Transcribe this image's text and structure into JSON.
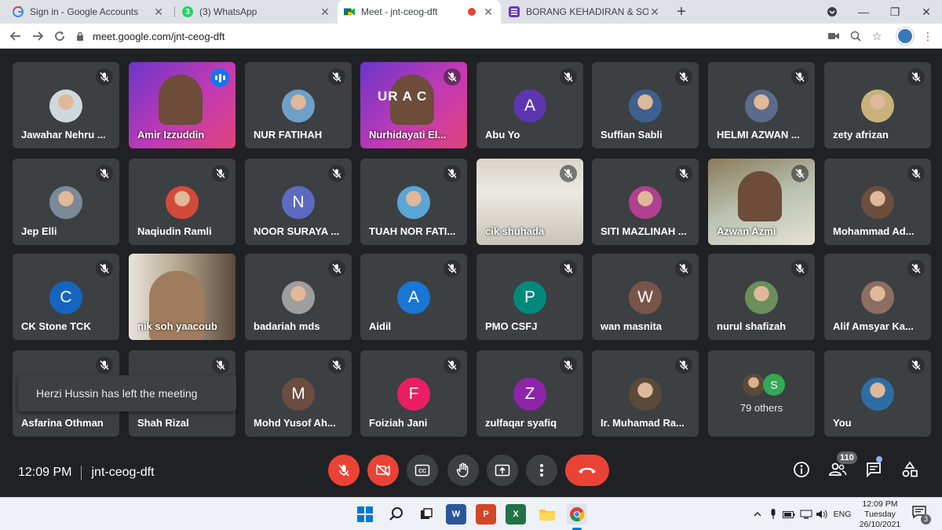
{
  "browser": {
    "tabs": [
      {
        "title": "Sign in - Google Accounts",
        "icon": "google-icon",
        "active": false
      },
      {
        "title": "(3) WhatsApp",
        "icon": "whatsapp-icon",
        "active": false,
        "badge": "3"
      },
      {
        "title": "Meet - jnt-ceog-dft",
        "icon": "meet-icon",
        "active": true,
        "recording": true
      },
      {
        "title": "BORANG KEHADIRAN & SOALAN",
        "icon": "forms-icon",
        "active": false
      }
    ],
    "url": "meet.google.com/jnt-ceog-dft"
  },
  "participants": [
    {
      "name": "Jawahar Nehru ...",
      "kind": "photo",
      "color": "#cfd8dc"
    },
    {
      "name": "Amir Izzuddin",
      "kind": "video",
      "speaking": true,
      "bg": "purple"
    },
    {
      "name": "NUR FATIHAH",
      "kind": "photo",
      "color": "#6fa0c8"
    },
    {
      "name": "Nurhidayati El...",
      "kind": "video",
      "bg": "purple",
      "overlay": "UR A C"
    },
    {
      "name": "Abu Yo",
      "kind": "letter",
      "letter": "A",
      "color": "#5e35b1"
    },
    {
      "name": "Suffian Sabli",
      "kind": "photo",
      "color": "#3f5f8f"
    },
    {
      "name": "HELMI AZWAN ...",
      "kind": "photo",
      "color": "#5b6b8a"
    },
    {
      "name": "zety afrizan",
      "kind": "photo",
      "color": "#c9b27a"
    },
    {
      "name": "Jep Elli",
      "kind": "photo",
      "color": "#7a8a99"
    },
    {
      "name": "Naqiudin Ramli",
      "kind": "photo",
      "color": "#d44a3a"
    },
    {
      "name": "NOOR SURAYA ...",
      "kind": "letter",
      "letter": "N",
      "color": "#5c6bc0"
    },
    {
      "name": "TUAH NOR FATI...",
      "kind": "photo",
      "color": "#5aa6d6"
    },
    {
      "name": "cik shuhada",
      "kind": "video",
      "bg": "room"
    },
    {
      "name": "SITI MAZLINAH ...",
      "kind": "photo",
      "color": "#b0418f"
    },
    {
      "name": "Azwan Azmi",
      "kind": "video",
      "bg": "office"
    },
    {
      "name": "Mohammad Ad...",
      "kind": "photo",
      "color": "#6b4e3d"
    },
    {
      "name": "CK Stone TCK",
      "kind": "letter",
      "letter": "C",
      "color": "#1565c0"
    },
    {
      "name": "nik soh yaacoub",
      "kind": "video",
      "bg": "study"
    },
    {
      "name": "badariah mds",
      "kind": "photo",
      "color": "#9e9e9e"
    },
    {
      "name": "Aidil",
      "kind": "letter",
      "letter": "A",
      "color": "#1976d2"
    },
    {
      "name": "PMO CSFJ",
      "kind": "letter",
      "letter": "P",
      "color": "#00897b"
    },
    {
      "name": "wan masnita",
      "kind": "letter",
      "letter": "W",
      "color": "#795548"
    },
    {
      "name": "nurul shafizah",
      "kind": "photo",
      "color": "#6b8f5a"
    },
    {
      "name": "Alif Amsyar Ka...",
      "kind": "photo",
      "color": "#8d6e63"
    },
    {
      "name": "Asfarina Othman",
      "kind": "hidden"
    },
    {
      "name": "Shah Rizal",
      "kind": "hidden"
    },
    {
      "name": "Mohd Yusof Ah...",
      "kind": "letter",
      "letter": "M",
      "color": "#6d4c41"
    },
    {
      "name": "Foiziah Jani",
      "kind": "letter",
      "letter": "F",
      "color": "#e91e63"
    },
    {
      "name": "zulfaqar syafiq",
      "kind": "letter",
      "letter": "Z",
      "color": "#8e24aa"
    },
    {
      "name": "Ir. Muhamad Ra...",
      "kind": "photo",
      "color": "#5a4a3a"
    },
    {
      "name": "79 others",
      "kind": "others",
      "letter": "S"
    },
    {
      "name": "You",
      "kind": "photo",
      "color": "#2e6da4"
    }
  ],
  "toast": "Herzi Hussin has left the meeting",
  "bottom": {
    "time": "12:09 PM",
    "meeting_code": "jnt-ceog-dft",
    "participant_count": "110"
  },
  "taskbar": {
    "lang": "ENG",
    "time": "12:09 PM",
    "day": "Tuesday",
    "date": "26/10/2021",
    "notifications": "3"
  },
  "colors": {
    "meet_bg": "#202124",
    "tile_bg": "#3c4043",
    "end_call": "#ea4335",
    "accent": "#1a73e8"
  }
}
